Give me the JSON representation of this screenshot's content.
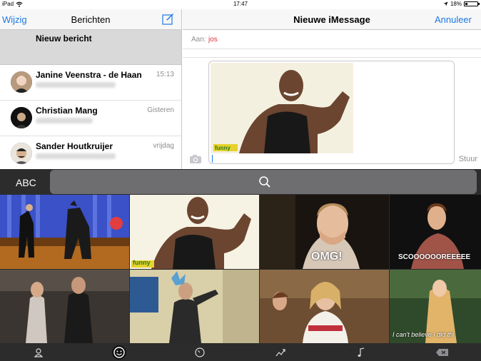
{
  "status": {
    "device": "iPad",
    "time": "17:47",
    "battery": "18%",
    "battery_fill": 0.18
  },
  "left": {
    "edit": "Wijzig",
    "title": "Berichten",
    "new_message": "Nieuw bericht",
    "conversations": [
      {
        "name": "Janine Veenstra - de Haan",
        "time": "15:13"
      },
      {
        "name": "Christian Mang",
        "time": "Gisteren"
      },
      {
        "name": "Sander Houtkruijer",
        "time": "vrijdag"
      }
    ]
  },
  "right": {
    "title": "Nieuwe iMessage",
    "cancel": "Annuleer",
    "to_label": "Aan:",
    "to_value": "jos",
    "send": "Stuur",
    "gif_caption": "funny"
  },
  "keyboard": {
    "abc": "ABC",
    "tiles": [
      {
        "caption": ""
      },
      {
        "caption": "funny"
      },
      {
        "caption": "OMG!"
      },
      {
        "caption": "SCOOOOOOREEEEE"
      },
      {
        "caption": ""
      },
      {
        "caption": ""
      },
      {
        "caption": ""
      },
      {
        "caption": "I can't believe I did thi"
      }
    ]
  },
  "colors": {
    "accent": "#1e78e6",
    "recipient": "#e0323a",
    "keyboard_bg": "#2c2c2d"
  },
  "icons": [
    "wifi-icon",
    "compose-icon",
    "camera-icon",
    "search-icon",
    "person-icon",
    "smiley-icon",
    "clock-icon",
    "trending-icon",
    "music-icon",
    "backspace-icon"
  ]
}
